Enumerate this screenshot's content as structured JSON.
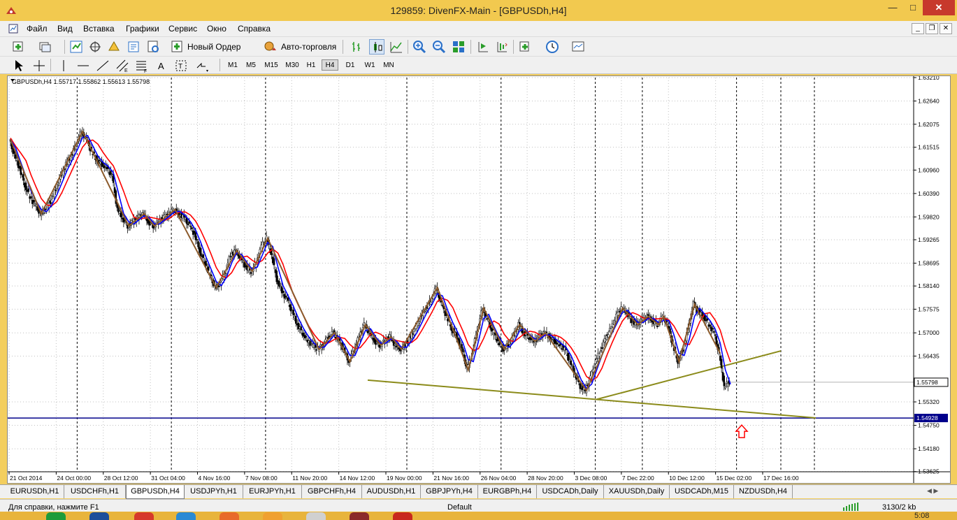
{
  "window": {
    "title": "129859: DivenFX-Main - [GBPUSDh,H4]",
    "minimize": "—",
    "maximize": "□",
    "close": "✕"
  },
  "menu": [
    "Файл",
    "Вид",
    "Вставка",
    "Графики",
    "Сервис",
    "Окно",
    "Справка"
  ],
  "toolbar": {
    "new_order": "Новый Ордер",
    "autotrading": "Авто-торговля"
  },
  "timeframes": [
    "M1",
    "M5",
    "M15",
    "M30",
    "H1",
    "H4",
    "D1",
    "W1",
    "MN"
  ],
  "active_timeframe": "H4",
  "chart_data": {
    "type": "candlestick",
    "header": "GBPUSDh,H4  1.55717 1.55862 1.55613 1.55798",
    "symbol": "GBPUSDh",
    "timeframe": "H4",
    "ylim": [
      1.5362,
      1.6321
    ],
    "y_ticks": [
      "1.63210",
      "1.62640",
      "1.62075",
      "1.61515",
      "1.60960",
      "1.60390",
      "1.59820",
      "1.59265",
      "1.58695",
      "1.58140",
      "1.57575",
      "1.57000",
      "1.56435",
      "1.55320",
      "1.54750",
      "1.54180",
      "1.53625"
    ],
    "x_ticks": [
      "21 Oct 2014",
      "24 Oct 00:00",
      "28 Oct 12:00",
      "31 Oct 04:00",
      "4 Nov 16:00",
      "7 Nov 08:00",
      "11 Nov 20:00",
      "14 Nov 12:00",
      "19 Nov 00:00",
      "21 Nov 16:00",
      "26 Nov 04:00",
      "28 Nov 20:00",
      "3 Dec 08:00",
      "7 Dec 22:00",
      "10 Dec 12:00",
      "15 Dec 02:00",
      "17 Dec 16:00"
    ],
    "current_price": "1.55798",
    "horizontal_line": "1.54928",
    "zigzag_color": "#8b5a2b",
    "ma_fast_color": "#0000ff",
    "ma_slow_color": "#ff0000",
    "trendline_color": "#8b8b1a",
    "hline_color": "#00008b",
    "up_arrow_color": "#ff0000",
    "close_path": [
      1.617,
      1.613,
      1.61,
      1.606,
      1.603,
      1.601,
      1.599,
      1.6,
      1.602,
      1.605,
      1.608,
      1.611,
      1.613,
      1.616,
      1.619,
      1.617,
      1.614,
      1.612,
      1.611,
      1.61,
      1.608,
      1.6,
      1.598,
      1.596,
      1.597,
      1.598,
      1.599,
      1.597,
      1.596,
      1.597,
      1.598,
      1.599,
      1.6,
      1.599,
      1.598,
      1.596,
      1.594,
      1.59,
      1.587,
      1.584,
      1.581,
      1.582,
      1.585,
      1.589,
      1.59,
      1.588,
      1.586,
      1.585,
      1.587,
      1.591,
      1.593,
      1.589,
      1.583,
      1.58,
      1.578,
      1.575,
      1.572,
      1.57,
      1.568,
      1.567,
      1.566,
      1.567,
      1.569,
      1.57,
      1.568,
      1.566,
      1.563,
      1.566,
      1.569,
      1.572,
      1.57,
      1.568,
      1.567,
      1.568,
      1.569,
      1.567,
      1.566,
      1.567,
      1.569,
      1.571,
      1.574,
      1.576,
      1.578,
      1.581,
      1.577,
      1.574,
      1.571,
      1.569,
      1.566,
      1.561,
      1.565,
      1.571,
      1.576,
      1.573,
      1.57,
      1.568,
      1.566,
      1.567,
      1.569,
      1.572,
      1.57,
      1.569,
      1.568,
      1.569,
      1.57,
      1.569,
      1.568,
      1.567,
      1.566,
      1.563,
      1.56,
      1.557,
      1.556,
      1.559,
      1.563,
      1.566,
      1.569,
      1.571,
      1.574,
      1.576,
      1.575,
      1.573,
      1.572,
      1.573,
      1.574,
      1.573,
      1.572,
      1.574,
      1.572,
      1.567,
      1.563,
      1.566,
      1.571,
      1.577,
      1.575,
      1.574,
      1.572,
      1.57,
      1.565,
      1.557,
      1.558
    ]
  },
  "search": {
    "placeholder": ""
  },
  "symbol_tabs": [
    "EURUSDh,H1",
    "USDCHFh,H1",
    "GBPUSDh,H4",
    "USDJPYh,H1",
    "EURJPYh,H1",
    "GBPCHFh,H4",
    "AUDUSDh,H1",
    "GBPJPYh,H4",
    "EURGBPh,H4",
    "USDCADh,Daily",
    "XAUUSDh,Daily",
    "USDCADh,M15",
    "NZDUSDh,H4"
  ],
  "active_tab": "GBPUSDh,H4",
  "status": {
    "help": "Для справки, нажмите F1",
    "profile": "Default",
    "traffic": "3130/2 kb"
  },
  "taskbar": {
    "clock": "5:08"
  }
}
